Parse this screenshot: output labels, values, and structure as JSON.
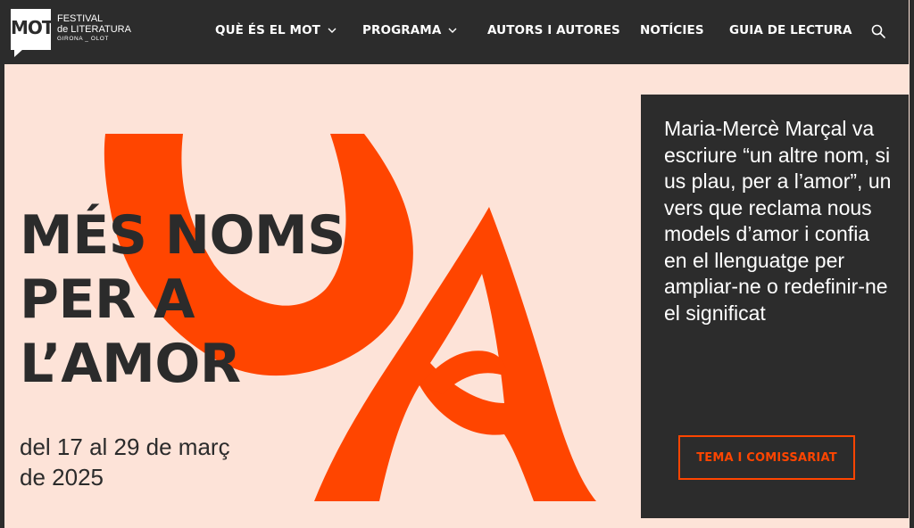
{
  "header": {
    "logo": {
      "mark": "MOT",
      "line1": "FESTIVAL",
      "line2": "de LITERATURA",
      "line3": "GIRONA _ OLOT"
    },
    "nav": [
      {
        "label": "QUÈ ÉS EL MOT",
        "has_dropdown": true
      },
      {
        "label": "PROGRAMA",
        "has_dropdown": true
      },
      {
        "label": "AUTORS I AUTORES",
        "has_dropdown": false
      },
      {
        "label": "NOTÍCIES",
        "has_dropdown": false
      },
      {
        "label": "GUIA DE LECTURA",
        "has_dropdown": false
      }
    ],
    "search_icon": "search-icon"
  },
  "hero": {
    "title_lines": [
      "MÉS NOMS",
      "PER A",
      "L’AMOR"
    ],
    "dates_line1": "del 17 al 29 de març",
    "dates_line2": "de 2025"
  },
  "card": {
    "quote": "Maria-Mercè Marçal va escriure “un altre nom, si us plau, per a l’amor”, un vers que reclama nous models d’amor i confia en el llenguatge per ampliar-ne o redefinir-ne el significat",
    "button_label": "TEMA I COMISSARIAT"
  },
  "colors": {
    "background": "#fde3d8",
    "dark": "#2c2c2c",
    "accent": "#ff4500"
  }
}
